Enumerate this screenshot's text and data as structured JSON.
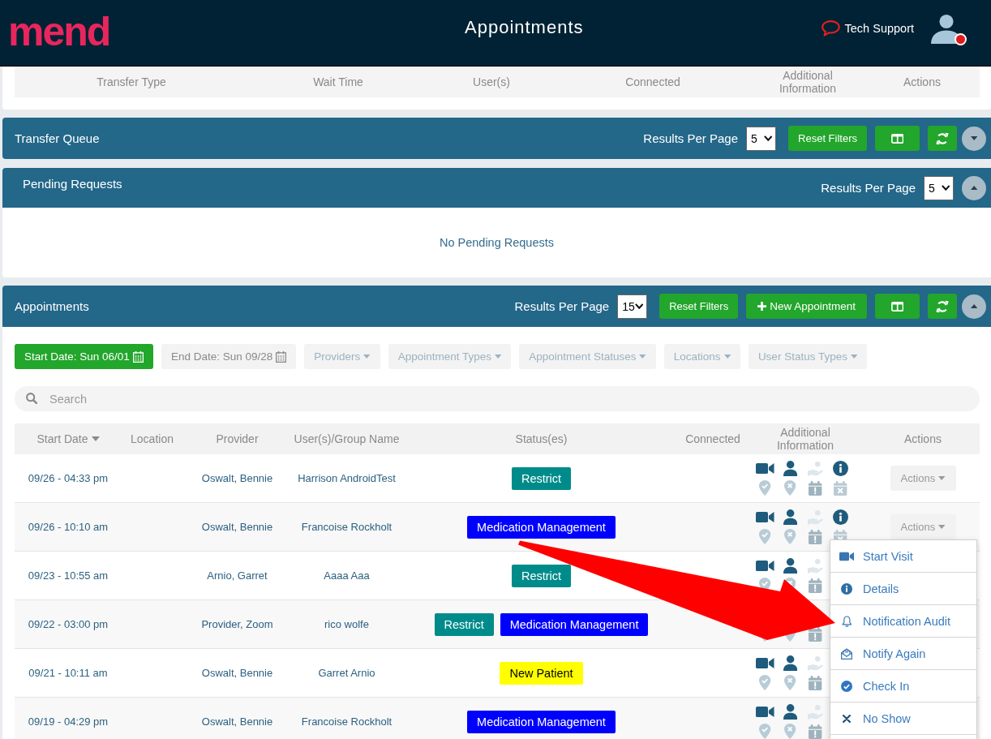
{
  "header": {
    "logo": "mend",
    "title": "Appointments",
    "support": "Tech Support",
    "avatar": {
      "notification": true
    }
  },
  "transfer_table": {
    "columns": [
      "Transfer Type",
      "Wait Time",
      "User(s)",
      "Connected",
      "Additional Information",
      "Actions"
    ]
  },
  "transfer_queue": {
    "title": "Transfer Queue",
    "per_page_label": "Results Per Page",
    "per_page": "5",
    "reset_button": "Reset Filters",
    "expanded": false
  },
  "pending_requests": {
    "title": "Pending Requests",
    "per_page_label": "Results Per Page",
    "per_page": "5",
    "expanded": true,
    "empty_message": "No Pending Requests"
  },
  "appointments": {
    "title": "Appointments",
    "per_page_label": "Results Per Page",
    "per_page": "15",
    "reset_button": "Reset Filters",
    "new_button": "New Appointment",
    "expanded": true,
    "filters": [
      {
        "label": "Start Date: Sun 06/01",
        "kind": "date",
        "active": true
      },
      {
        "label": "End Date: Sun 09/28",
        "kind": "date",
        "active": false
      },
      {
        "label": "Providers",
        "kind": "dropdown",
        "active": false
      },
      {
        "label": "Appointment Types",
        "kind": "dropdown",
        "active": false
      },
      {
        "label": "Appointment Statuses",
        "kind": "dropdown",
        "active": false
      },
      {
        "label": "Locations",
        "kind": "dropdown",
        "active": false
      },
      {
        "label": "User Status Types",
        "kind": "dropdown",
        "active": false
      }
    ],
    "search": {
      "placeholder": "Search"
    },
    "columns": [
      {
        "label": "Start Date",
        "sorted": true
      },
      {
        "label": "Location",
        "sorted": false
      },
      {
        "label": "Provider",
        "sorted": false
      },
      {
        "label": "User(s)/Group Name",
        "sorted": false
      },
      {
        "label": "Status(es)",
        "sorted": false
      },
      {
        "label": "Connected",
        "sorted": false
      },
      {
        "label": "Additional Information",
        "sorted": false
      },
      {
        "label": "Actions",
        "sorted": false
      }
    ],
    "rows": [
      {
        "start": "09/26 - 04:33 pm",
        "provider": "Oswalt, Bennie",
        "users": "Harrison AndroidTest",
        "statuses": [
          {
            "label": "Restrict",
            "color": "#008b8b"
          }
        ],
        "info_icons": [
          {
            "kind": "video",
            "active": true
          },
          {
            "kind": "person",
            "active": true
          },
          {
            "kind": "payment",
            "active": false
          },
          {
            "kind": "info",
            "active": true
          },
          {
            "kind": "check-in",
            "active": false
          },
          {
            "kind": "no-show",
            "active": false
          },
          {
            "kind": "alert",
            "active": false
          },
          {
            "kind": "cancel",
            "active": false
          }
        ],
        "actions": "Actions"
      },
      {
        "start": "09/26 - 10:10 am",
        "provider": "Oswalt, Bennie",
        "users": "Francoise Rockholt",
        "statuses": [
          {
            "label": "Medication Management",
            "color": "#0000ff"
          }
        ],
        "info_icons": [
          {
            "kind": "video",
            "active": true
          },
          {
            "kind": "person",
            "active": true
          },
          {
            "kind": "payment",
            "active": false
          },
          {
            "kind": "info",
            "active": true
          },
          {
            "kind": "check-in",
            "active": false
          },
          {
            "kind": "no-show",
            "active": false
          },
          {
            "kind": "alert",
            "active": false
          },
          {
            "kind": "cancel",
            "active": false
          }
        ],
        "actions": "Actions"
      },
      {
        "start": "09/23 - 10:55 am",
        "provider": "Arnio, Garret",
        "users": "Aaaa Aaa",
        "statuses": [
          {
            "label": "Restrict",
            "color": "#008b8b"
          }
        ],
        "info_icons": [
          {
            "kind": "video",
            "active": true
          },
          {
            "kind": "person",
            "active": true
          },
          {
            "kind": "payment",
            "active": false
          },
          {
            "kind": "check-in",
            "active": false
          },
          {
            "kind": "no-show",
            "active": false
          },
          {
            "kind": "alert",
            "active": false
          }
        ]
      },
      {
        "start": "09/22 - 03:00 pm",
        "provider": "Provider, Zoom",
        "users": "rico wolfe",
        "statuses": [
          {
            "label": "Restrict",
            "color": "#008b8b"
          },
          {
            "label": "Medication Management",
            "color": "#0000ff"
          }
        ],
        "info_icons": [
          {
            "kind": "check-in",
            "active": false
          },
          {
            "kind": "no-show",
            "active": false
          },
          {
            "kind": "alert",
            "active": false
          }
        ]
      },
      {
        "start": "09/21 - 10:11 am",
        "provider": "Oswalt, Bennie",
        "users": "Garret Arnio",
        "statuses": [
          {
            "label": "New Patient",
            "color": "#ffff00"
          }
        ],
        "info_icons": [
          {
            "kind": "video",
            "active": true
          },
          {
            "kind": "person",
            "active": true
          },
          {
            "kind": "payment",
            "active": false
          },
          {
            "kind": "check-in",
            "active": false
          },
          {
            "kind": "no-show",
            "active": false
          },
          {
            "kind": "alert",
            "active": false
          }
        ]
      },
      {
        "start": "09/19 - 04:29 pm",
        "provider": "Oswalt, Bennie",
        "users": "Francoise Rockholt",
        "statuses": [
          {
            "label": "Medication Management",
            "color": "#0000ff"
          }
        ],
        "info_icons": [
          {
            "kind": "video",
            "active": true
          },
          {
            "kind": "person",
            "active": true
          },
          {
            "kind": "payment",
            "active": false
          },
          {
            "kind": "check-in",
            "active": false
          },
          {
            "kind": "no-show",
            "active": false
          },
          {
            "kind": "alert",
            "active": false
          }
        ]
      }
    ]
  },
  "actions_menu": {
    "items": [
      {
        "label": "Start Visit",
        "kind": "video"
      },
      {
        "label": "Details",
        "kind": "info"
      },
      {
        "label": "Notification Audit",
        "kind": "bell"
      },
      {
        "label": "Notify Again",
        "kind": "notify"
      },
      {
        "label": "Check In",
        "kind": "check"
      },
      {
        "label": "No Show",
        "kind": "cross"
      }
    ]
  }
}
